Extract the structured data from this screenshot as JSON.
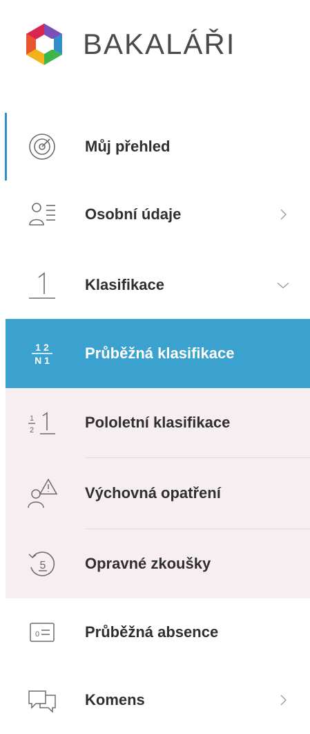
{
  "brand": {
    "name": "BAKALÁŘI"
  },
  "nav": {
    "items": [
      {
        "label": "Můj přehled",
        "icon": "dashboard-gauge-icon",
        "active": true
      },
      {
        "label": "Osobní údaje",
        "icon": "person-card-icon",
        "expandable": true,
        "expanded": false
      },
      {
        "label": "Klasifikace",
        "icon": "grade-one-icon",
        "expandable": true,
        "expanded": true
      }
    ],
    "subitems": [
      {
        "label": "Průběžná klasifikace",
        "icon": "grades-12-n1-icon",
        "selected": true
      },
      {
        "label": "Pololetní klasifikace",
        "icon": "half-year-grade-icon"
      },
      {
        "label": "Výchovná opatření",
        "icon": "person-warning-icon"
      },
      {
        "label": "Opravné zkoušky",
        "icon": "retake-five-icon"
      }
    ],
    "after": [
      {
        "label": "Průběžná absence",
        "icon": "absence-card-icon"
      },
      {
        "label": "Komens",
        "icon": "chat-bubbles-icon",
        "expandable": true,
        "expanded": false
      }
    ]
  },
  "colors": {
    "accent": "#2f8fca",
    "selected_bg": "#3ba1cf",
    "submenu_bg": "#f6eef1",
    "text": "#2f2f2f"
  }
}
